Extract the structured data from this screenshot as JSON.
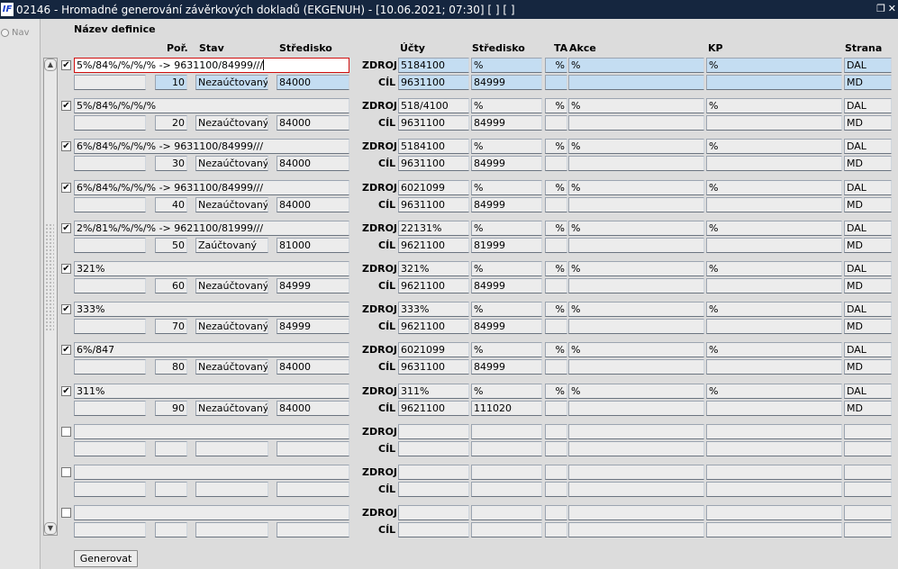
{
  "window": {
    "icon_text": "IF",
    "title": "02146 - Hromadné generování závěrkových dokladů (EKGENUH) - [10.06.2021; 07:30]  [ ]  [ ]",
    "restore_glyph": "❐",
    "close_glyph": "✕"
  },
  "nav": {
    "label": "Nav"
  },
  "headers": {
    "nazev": "Název definice",
    "por": "Poř.",
    "stav": "Stav",
    "stredisko_left": "Středisko",
    "ucty": "Účty",
    "stredisko_right": "Středisko",
    "ta": "TA",
    "akce": "Akce",
    "kp": "KP",
    "strana": "Strana"
  },
  "labels": {
    "zdroj": "ZDROJ",
    "cil": "CÍL"
  },
  "icons": {
    "check_glyph": "✔",
    "scroll_up": "▲",
    "scroll_down": "▼"
  },
  "records": [
    {
      "checked": true,
      "name": "5%/84%/%/%/% -> 9631100/84999///",
      "aux": "",
      "por": "10",
      "stav": "Nezaúčtovaný",
      "stredisko": "84000",
      "zdroj": {
        "ucet": "5184100",
        "str": "%",
        "ta": "%",
        "akce": "%",
        "kp": "%",
        "strana": "DAL"
      },
      "cil": {
        "ucet": "9631100",
        "str": "84999",
        "ta": "",
        "akce": "",
        "kp": "",
        "strana": "MD"
      }
    },
    {
      "checked": true,
      "name": "5%/84%/%/%/%",
      "aux": "",
      "por": "20",
      "stav": "Nezaúčtovaný",
      "stredisko": "84000",
      "zdroj": {
        "ucet": "518/4100",
        "str": "%",
        "ta": "%",
        "akce": "%",
        "kp": "%",
        "strana": "DAL"
      },
      "cil": {
        "ucet": "9631100",
        "str": "84999",
        "ta": "",
        "akce": "",
        "kp": "",
        "strana": "MD"
      }
    },
    {
      "checked": true,
      "name": "6%/84%/%/%/% -> 9631100/84999///",
      "aux": "",
      "por": "30",
      "stav": "Nezaúčtovaný",
      "stredisko": "84000",
      "zdroj": {
        "ucet": "5184100",
        "str": "%",
        "ta": "%",
        "akce": "%",
        "kp": "%",
        "strana": "DAL"
      },
      "cil": {
        "ucet": "9631100",
        "str": "84999",
        "ta": "",
        "akce": "",
        "kp": "",
        "strana": "MD"
      }
    },
    {
      "checked": true,
      "name": "6%/84%/%/%/% -> 9631100/84999///",
      "aux": "",
      "por": "40",
      "stav": "Nezaúčtovaný",
      "stredisko": "84000",
      "zdroj": {
        "ucet": "6021099",
        "str": "%",
        "ta": "%",
        "akce": "%",
        "kp": "%",
        "strana": "DAL"
      },
      "cil": {
        "ucet": "9631100",
        "str": "84999",
        "ta": "",
        "akce": "",
        "kp": "",
        "strana": "MD"
      }
    },
    {
      "checked": true,
      "name": "2%/81%/%/%/% -> 9621100/81999///",
      "aux": "",
      "por": "50",
      "stav": "Zaúčtovaný",
      "stredisko": "81000",
      "zdroj": {
        "ucet": "22131%",
        "str": "%",
        "ta": "%",
        "akce": "%",
        "kp": "%",
        "strana": "DAL"
      },
      "cil": {
        "ucet": "9621100",
        "str": "81999",
        "ta": "",
        "akce": "",
        "kp": "",
        "strana": "MD"
      }
    },
    {
      "checked": true,
      "name": "321%",
      "aux": "",
      "por": "60",
      "stav": "Nezaúčtovaný",
      "stredisko": "84999",
      "zdroj": {
        "ucet": "321%",
        "str": "%",
        "ta": "%",
        "akce": "%",
        "kp": "%",
        "strana": "DAL"
      },
      "cil": {
        "ucet": "9621100",
        "str": "84999",
        "ta": "",
        "akce": "",
        "kp": "",
        "strana": "MD"
      }
    },
    {
      "checked": true,
      "name": "333%",
      "aux": "",
      "por": "70",
      "stav": "Nezaúčtovaný",
      "stredisko": "84999",
      "zdroj": {
        "ucet": "333%",
        "str": "%",
        "ta": "%",
        "akce": "%",
        "kp": "%",
        "strana": "DAL"
      },
      "cil": {
        "ucet": "9621100",
        "str": "84999",
        "ta": "",
        "akce": "",
        "kp": "",
        "strana": "MD"
      }
    },
    {
      "checked": true,
      "name": "6%/847",
      "aux": "",
      "por": "80",
      "stav": "Nezaúčtovaný",
      "stredisko": "84000",
      "zdroj": {
        "ucet": "6021099",
        "str": "%",
        "ta": "%",
        "akce": "%",
        "kp": "%",
        "strana": "DAL"
      },
      "cil": {
        "ucet": "9631100",
        "str": "84999",
        "ta": "",
        "akce": "",
        "kp": "",
        "strana": "MD"
      }
    },
    {
      "checked": true,
      "name": "311%",
      "aux": "",
      "por": "90",
      "stav": "Nezaúčtovaný",
      "stredisko": "84000",
      "zdroj": {
        "ucet": "311%",
        "str": "%",
        "ta": "%",
        "akce": "%",
        "kp": "%",
        "strana": "DAL"
      },
      "cil": {
        "ucet": "9621100",
        "str": "111020",
        "ta": "",
        "akce": "",
        "kp": "",
        "strana": "MD"
      }
    },
    {
      "checked": false,
      "name": "",
      "aux": "",
      "por": "",
      "stav": "",
      "stredisko": "",
      "zdroj": {
        "ucet": "",
        "str": "",
        "ta": "",
        "akce": "",
        "kp": "",
        "strana": ""
      },
      "cil": {
        "ucet": "",
        "str": "",
        "ta": "",
        "akce": "",
        "kp": "",
        "strana": ""
      }
    },
    {
      "checked": false,
      "name": "",
      "aux": "",
      "por": "",
      "stav": "",
      "stredisko": "",
      "zdroj": {
        "ucet": "",
        "str": "",
        "ta": "",
        "akce": "",
        "kp": "",
        "strana": ""
      },
      "cil": {
        "ucet": "",
        "str": "",
        "ta": "",
        "akce": "",
        "kp": "",
        "strana": ""
      }
    },
    {
      "checked": false,
      "name": "",
      "aux": "",
      "por": "",
      "stav": "",
      "stredisko": "",
      "zdroj": {
        "ucet": "",
        "str": "",
        "ta": "",
        "akce": "",
        "kp": "",
        "strana": ""
      },
      "cil": {
        "ucet": "",
        "str": "",
        "ta": "",
        "akce": "",
        "kp": "",
        "strana": ""
      }
    }
  ],
  "button": {
    "generovat": "Generovat"
  }
}
